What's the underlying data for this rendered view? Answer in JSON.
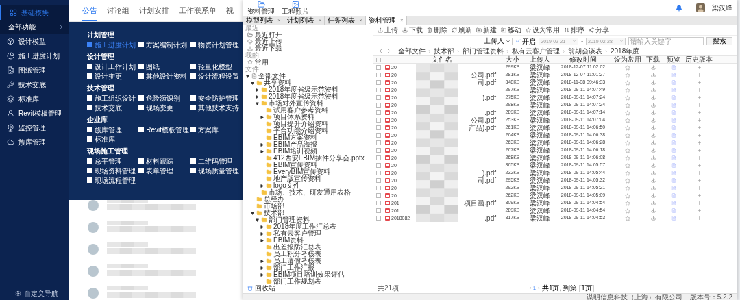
{
  "sidebar": {
    "items": [
      {
        "kind": "module",
        "label": "基础模块",
        "selected": true
      },
      {
        "kind": "all",
        "label": "全部功能",
        "selected": false
      },
      {
        "kind": "link",
        "label": "设计模型",
        "selected": false
      },
      {
        "kind": "link",
        "label": "施工进度计划",
        "selected": false
      },
      {
        "kind": "link",
        "label": "图纸管理",
        "selected": false
      },
      {
        "kind": "link",
        "label": "技术交底",
        "selected": false
      },
      {
        "kind": "link",
        "label": "标准库",
        "selected": false
      },
      {
        "kind": "link",
        "label": "Revit模板管理",
        "selected": false
      },
      {
        "kind": "link",
        "label": "监控管理",
        "selected": false
      },
      {
        "kind": "link",
        "label": "族库管理",
        "selected": false
      }
    ],
    "footer": "自定义导航"
  },
  "tabs": [
    {
      "label": "公告",
      "selected": true
    },
    {
      "label": "讨论组",
      "selected": false
    },
    {
      "label": "计划安排",
      "selected": false
    },
    {
      "label": "工作联系单",
      "selected": false
    },
    {
      "label": "视",
      "selected": false
    }
  ],
  "mega_menu": {
    "groups": [
      {
        "title": "计划管理",
        "items": [
          {
            "label": "施工进度计划",
            "checked": true
          },
          {
            "label": "方案编制计划",
            "checked": false
          },
          {
            "label": "物资计划管理",
            "checked": false
          }
        ]
      },
      {
        "title": "设计管理",
        "items": [
          {
            "label": "设计工作计划",
            "checked": false
          },
          {
            "label": "图纸",
            "checked": false
          },
          {
            "label": "轻量化模型",
            "checked": false
          },
          {
            "label": "设计变更",
            "checked": false
          },
          {
            "label": "其他设计资料",
            "checked": false
          },
          {
            "label": "设计流程设置",
            "checked": false
          }
        ]
      },
      {
        "title": "技术管理",
        "items": [
          {
            "label": "施工组织设计",
            "checked": false
          },
          {
            "label": "危险源识别",
            "checked": false
          },
          {
            "label": "安全防护管理",
            "checked": false
          },
          {
            "label": "技术交底",
            "checked": false
          },
          {
            "label": "现场变更",
            "checked": false
          },
          {
            "label": "其他技术支持",
            "checked": false
          }
        ]
      },
      {
        "title": "企业库",
        "items": [
          {
            "label": "族库管理",
            "checked": false
          },
          {
            "label": "Revit模板管理",
            "checked": false
          },
          {
            "label": "方案库",
            "checked": false
          },
          {
            "label": "标准库",
            "checked": false
          }
        ]
      },
      {
        "title": "现场施工管理",
        "items": [
          {
            "label": "总平管理",
            "checked": false
          },
          {
            "label": "材料跟踪",
            "checked": false
          },
          {
            "label": "二维码管理",
            "checked": false
          },
          {
            "label": "现场资料管理",
            "checked": false
          },
          {
            "label": "表单管理",
            "checked": false
          },
          {
            "label": "现场质量管理",
            "checked": false
          },
          {
            "label": "现场流程管理",
            "checked": false
          }
        ]
      }
    ]
  },
  "feed": [
    {
      "kind": "redacted"
    },
    {
      "kind": "redacted"
    },
    {
      "kind": "redacted"
    },
    {
      "kind": "redacted"
    },
    {
      "kind": "redacted"
    }
  ],
  "window": {
    "toolbar": [
      {
        "label": "资料管理"
      },
      {
        "label": "工程照片"
      }
    ],
    "user": {
      "name": "梁汉峰"
    },
    "tabs": [
      {
        "label": "模型列表",
        "close": "×",
        "selected": false
      },
      {
        "label": "计划列表",
        "close": "×",
        "selected": false
      },
      {
        "label": "任务列表",
        "close": "×",
        "selected": false
      },
      {
        "label": "资料管理",
        "close": "×",
        "selected": true
      }
    ],
    "tree": {
      "sections": [
        {
          "heading": "最近",
          "items": [
            {
              "label": "最近打开"
            },
            {
              "label": "最近上传"
            },
            {
              "label": "最近下载"
            }
          ]
        },
        {
          "heading": "我的",
          "items": [
            {
              "label": "常用"
            }
          ]
        },
        {
          "heading": "文件"
        }
      ],
      "root": {
        "label": "全部文件",
        "kind": "expanded",
        "children": [
          {
            "label": "共享资料",
            "kind": "expanded",
            "children": [
              {
                "label": "2018年度省级示范资料",
                "kind": "collapsed"
              },
              {
                "label": "2018年度省级示范资料",
                "kind": "collapsed"
              },
              {
                "label": "市场对外宣传资料",
                "kind": "expanded",
                "children": [
                  {
                    "label": "试用客户参考资料",
                    "kind": "leaf"
                  },
                  {
                    "label": "项目体系资料",
                    "kind": "collapsed"
                  },
                  {
                    "label": "项目提升介绍资料",
                    "kind": "leaf"
                  },
                  {
                    "label": "平台功能介绍资料",
                    "kind": "leaf"
                  },
                  {
                    "label": "EBIM方案资料",
                    "kind": "leaf"
                  },
                  {
                    "label": "EBIM产品海报",
                    "kind": "collapsed"
                  },
                  {
                    "label": "EBIM培训视频",
                    "kind": "collapsed"
                  },
                  {
                    "label": "412西安EBIM插件分享会.pptx",
                    "kind": "leaf"
                  },
                  {
                    "label": "EBIM宣传资料",
                    "kind": "leaf"
                  },
                  {
                    "label": "EveryBIM宣传资料",
                    "kind": "leaf"
                  },
                  {
                    "label": "地产版宣传资料",
                    "kind": "leaf"
                  },
                  {
                    "label": "logo文件",
                    "kind": "collapsed"
                  }
                ]
              },
              {
                "label": "市场、技术、研发通用表格",
                "kind": "leaf"
              }
            ]
          },
          {
            "label": "总经办",
            "kind": "leaf"
          },
          {
            "label": "市场部",
            "kind": "leaf"
          },
          {
            "label": "技术部",
            "kind": "expanded",
            "children": [
              {
                "label": "部门管理资料",
                "kind": "expanded",
                "children": [
                  {
                    "label": "2018年度工作汇总表",
                    "kind": "collapsed"
                  },
                  {
                    "label": "私有云客户管理",
                    "kind": "collapsed"
                  },
                  {
                    "label": "EBIM资料",
                    "kind": "collapsed"
                  },
                  {
                    "label": "出差报防汇总表",
                    "kind": "leaf"
                  },
                  {
                    "label": "员工积分考核表",
                    "kind": "leaf"
                  },
                  {
                    "label": "员工请假考核表",
                    "kind": "collapsed"
                  },
                  {
                    "label": "部门工作汇报",
                    "kind": "collapsed"
                  },
                  {
                    "label": "EBIM项目培训效果评估",
                    "kind": "collapsed"
                  },
                  {
                    "label": "部门工作规划表",
                    "kind": "leaf"
                  }
                ]
              }
            ]
          }
        ]
      },
      "trash": "回收站"
    },
    "actions": [
      {
        "label": "上传"
      },
      {
        "label": "下载"
      },
      {
        "label": "删除"
      },
      {
        "label": "刷新"
      },
      {
        "label": "新建"
      },
      {
        "label": "移动"
      },
      {
        "label": "设为常用"
      },
      {
        "label": "排序"
      },
      {
        "label": "分享"
      }
    ],
    "filter": {
      "uploader": "上传人",
      "enable": {
        "label": "开启",
        "checked": true
      },
      "date_from": "2019-02-21",
      "separator": "-",
      "date_to": "2019-02-28",
      "placeholder": "请输入关键字",
      "button": "搜索"
    },
    "breadcrumb": [
      "全部文件",
      "技术部",
      "部门管理资料",
      "私有云客户管理",
      "前期会谈表",
      "2018年度"
    ],
    "select_all": {
      "checked": false
    },
    "columns": [
      "文件名",
      "大小",
      "上传人",
      "修改时间",
      "设为常用",
      "下载",
      "预览",
      "历史版本"
    ],
    "rows": [
      {
        "name_start": "20",
        "size": "299KB",
        "uploader": "梁汉峰",
        "modified": "2018-12-07 11:02:02",
        "checked": false
      },
      {
        "name_start": "20",
        "name_end": "公司.pdf",
        "size": "281KB",
        "uploader": "梁汉峰",
        "modified": "2018-12-07 11:01:27",
        "checked": false
      },
      {
        "name_start": "20",
        "name_end": "司.pdf",
        "size": "348KB",
        "uploader": "梁汉峰",
        "modified": "2018-11-08 09:46:33",
        "checked": false
      },
      {
        "name_start": "20",
        "size": "297KB",
        "uploader": "梁汉峰",
        "modified": "2018-09-11 14:07:49",
        "checked": false
      },
      {
        "name_start": "20",
        "name_end": ").pdf",
        "size": "275KB",
        "uploader": "梁汉峰",
        "modified": "2018-09-11 14:07:24",
        "checked": false
      },
      {
        "name_start": "20",
        "size": "298KB",
        "uploader": "梁汉峰",
        "modified": "2018-09-11 14:07:24",
        "checked": false
      },
      {
        "name_start": "20",
        "name_end": ".pdf",
        "size": "289KB",
        "uploader": "梁汉峰",
        "modified": "2018-09-11 14:07:14",
        "checked": false
      },
      {
        "name_start": "20",
        "name_end": "公司.pdf",
        "size": "253KB",
        "uploader": "梁汉峰",
        "modified": "2018-09-11 14:07:04",
        "checked": false
      },
      {
        "name_start": "20",
        "name_end": "产品).pdf",
        "size": "261KB",
        "uploader": "梁汉峰",
        "modified": "2018-09-11 14:06:50",
        "checked": false
      },
      {
        "name_start": "20",
        "size": "264KB",
        "uploader": "梁汉峰",
        "modified": "2018-09-11 14:06:38",
        "checked": false
      },
      {
        "name_start": "20",
        "size": "263KB",
        "uploader": "梁汉峰",
        "modified": "2018-09-11 14:06:28",
        "checked": false
      },
      {
        "name_start": "20",
        "size": "267KB",
        "uploader": "梁汉峰",
        "modified": "2018-09-11 14:06:18",
        "checked": false
      },
      {
        "name_start": "20",
        "size": "268KB",
        "uploader": "梁汉峰",
        "modified": "2018-09-11 14:06:08",
        "checked": false
      },
      {
        "name_start": "20",
        "size": "365KB",
        "uploader": "梁汉峰",
        "modified": "2018-09-11 14:05:57",
        "checked": false
      },
      {
        "name_start": "20",
        "name_end": ").pdf",
        "size": "232KB",
        "uploader": "梁汉峰",
        "modified": "2018-09-11 14:05:44",
        "checked": false
      },
      {
        "name_start": "20",
        "name_end": "司.pdf",
        "size": "295KB",
        "uploader": "梁汉峰",
        "modified": "2018-09-11 14:05:32",
        "checked": false
      },
      {
        "name_start": "20",
        "size": "292KB",
        "uploader": "梁汉峰",
        "modified": "2018-09-11 14:05:21",
        "checked": false
      },
      {
        "name_start": "20",
        "size": "262KB",
        "uploader": "梁汉峰",
        "modified": "2018-09-11 14:05:09",
        "checked": false
      },
      {
        "name_start": "201",
        "name_end": "项目函.pdf",
        "size": "309KB",
        "uploader": "梁汉峰",
        "modified": "2018-09-11 14:04:54",
        "checked": false
      },
      {
        "name_start": "201",
        "size": "289KB",
        "uploader": "梁汉峰",
        "modified": "2018-09-11 14:04:54",
        "checked": false
      },
      {
        "name_start": "2018082",
        "name_end": ".pdf",
        "size": "317KB",
        "uploader": "梁汉峰",
        "modified": "2018-09-11 14:04:53",
        "checked": false
      }
    ],
    "total": "共21项",
    "pagination": {
      "prev": "‹",
      "page": "1",
      "next": "›",
      "pages": "共1页,",
      "goto": "到第",
      "goto_value": "1页"
    },
    "status_bar": "谋明信息科技（上海）有限公司    版本号：5.2.2"
  }
}
